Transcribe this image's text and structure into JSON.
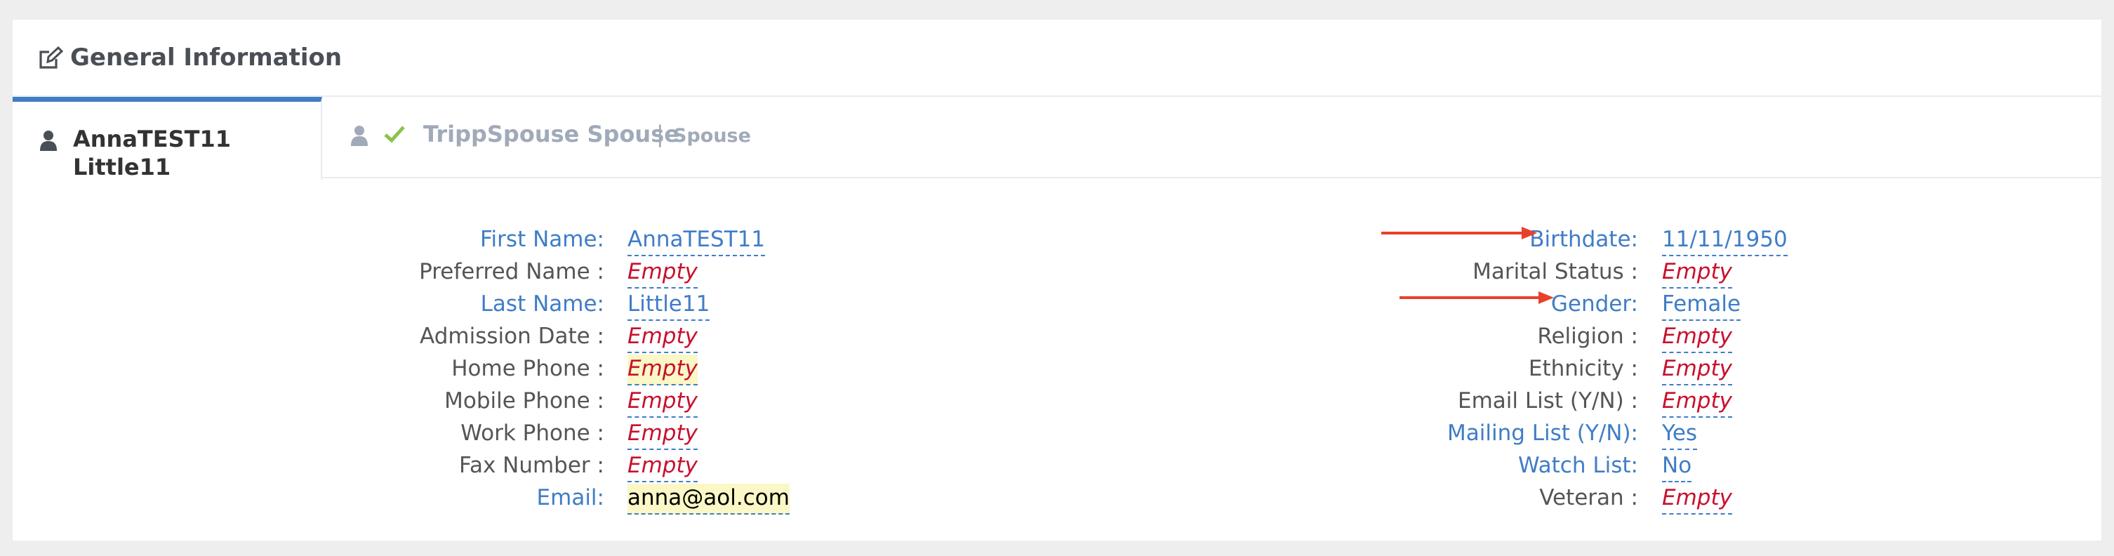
{
  "header": {
    "title": "General Information",
    "icon": "edit-icon"
  },
  "tabs": [
    {
      "label": "AnnaTEST11 Little11",
      "icon": "user-icon",
      "active": true
    },
    {
      "label": "TrippSpouse Spouse",
      "separator": "|",
      "role": "Spouse",
      "icon": "user-icon",
      "status_icon": "check-icon",
      "active": false
    }
  ],
  "left_fields": [
    {
      "label": "First Name",
      "suffix": ":",
      "value": "AnnaTEST11"
    },
    {
      "label": "Preferred Name",
      "suffix": " :",
      "value": "Empty"
    },
    {
      "label": "Last Name",
      "suffix": ":",
      "value": "Little11"
    },
    {
      "label": "Admission Date",
      "suffix": " :",
      "value": "Empty"
    },
    {
      "label": "Home Phone",
      "suffix": " :",
      "value": "Empty"
    },
    {
      "label": "Mobile Phone",
      "suffix": " :",
      "value": "Empty"
    },
    {
      "label": "Work Phone",
      "suffix": " :",
      "value": "Empty"
    },
    {
      "label": "Fax Number",
      "suffix": " :",
      "value": "Empty"
    },
    {
      "label": "Email",
      "suffix": ":",
      "value": "anna@aol.com"
    }
  ],
  "right_fields": [
    {
      "label": "Birthdate",
      "suffix": ":",
      "value": "11/11/1950"
    },
    {
      "label": "Marital Status",
      "suffix": " :",
      "value": "Empty"
    },
    {
      "label": "Gender",
      "suffix": ":",
      "value": "Female"
    },
    {
      "label": "Religion",
      "suffix": " :",
      "value": "Empty"
    },
    {
      "label": "Ethnicity",
      "suffix": " :",
      "value": "Empty"
    },
    {
      "label": "Email List (Y/N)",
      "suffix": " :",
      "value": "Empty"
    },
    {
      "label": "Mailing List (Y/N)",
      "suffix": ":",
      "value": "Yes"
    },
    {
      "label": "Watch List",
      "suffix": ":",
      "value": "No"
    },
    {
      "label": "Veteran",
      "suffix": " :",
      "value": "Empty"
    }
  ],
  "colors": {
    "link": "#3f7dc6",
    "empty": "#c8102e",
    "arrow": "#e8412b",
    "check": "#8bc34a"
  }
}
